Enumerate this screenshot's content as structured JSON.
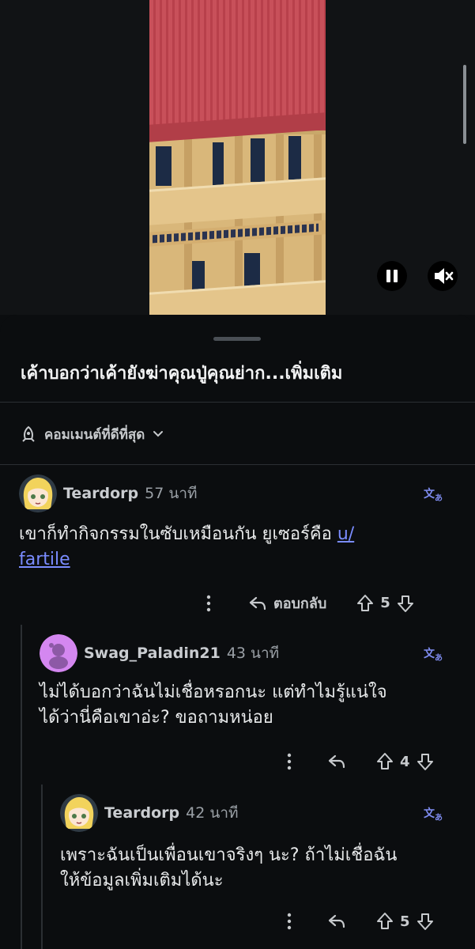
{
  "video": {
    "pause_icon": "pause-icon",
    "mute_icon": "volume-mute-icon"
  },
  "post": {
    "title": "เค้าบอกว่าเค้ายังฆ่าคุณปู่คุณย่าก...เพิ่มเติม"
  },
  "sort": {
    "icon": "rocket-icon",
    "label": "คอมเมนต์ที่ดีที่สุด",
    "chevron": "chevron-down-icon"
  },
  "comments": [
    {
      "username": "Teardorp",
      "time": "57 นาที",
      "body_line1": "เขาก็ทำกิจกรรมในซับเหมือนกัน ยูเซอร์คือ ",
      "link_part1": "u/",
      "link_part2": "fartile",
      "reply_label": "ตอบกลับ",
      "score": "5",
      "translate_icon": "translate-icon"
    },
    {
      "username": "Swag_Paladin21",
      "time": "43 นาที",
      "body_line1": "ไม่ได้บอกว่าฉันไม่เชื่อหรอกนะ แต่ทำไมรู้แน่ใจ",
      "body_line2": "ได้ว่านี่คือเขาอ่ะ? ขอถามหน่อย",
      "score": "4",
      "translate_icon": "translate-icon"
    },
    {
      "username": "Teardorp",
      "time": "42 นาที",
      "body_line1": "เพราะฉันเป็นเพื่อนเขาจริงๆ นะ? ถ้าไม่เชื่อฉัน",
      "body_line2": "ให้ข้อมูลเพิ่มเติมได้นะ",
      "score": "5",
      "translate_icon": "translate-icon"
    }
  ],
  "colors": {
    "background": "#0b0d0f",
    "link": "#7a8cff",
    "translate": "#7f8cf0"
  }
}
